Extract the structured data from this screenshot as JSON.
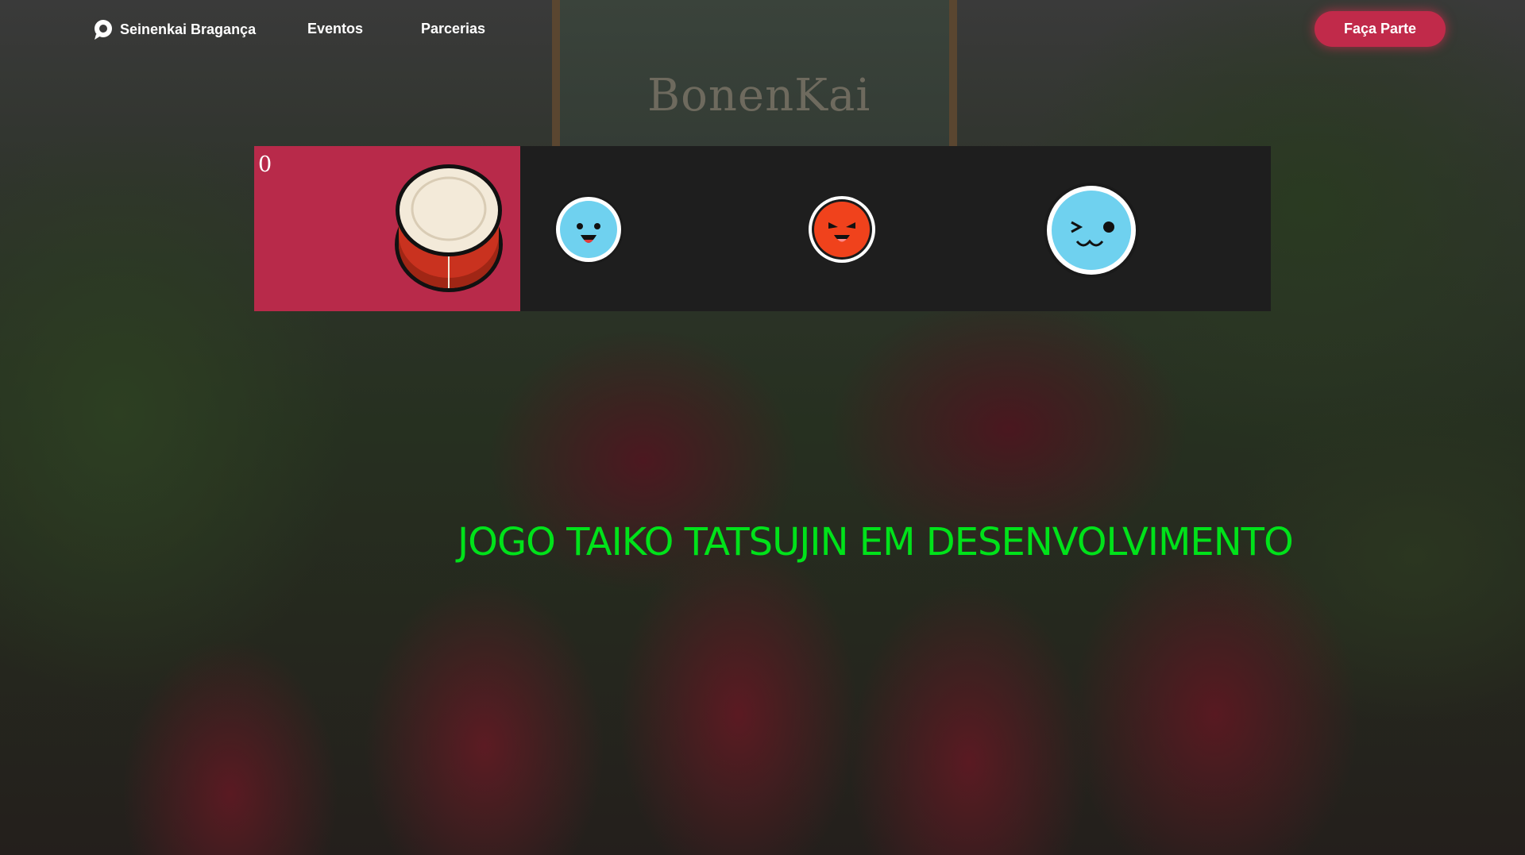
{
  "nav": {
    "brand": "Seinenkai Bragança",
    "links": [
      "Eventos",
      "Parcerias"
    ],
    "cta": "Faça Parte"
  },
  "background": {
    "board_text": "BonenKai"
  },
  "game": {
    "score": "0",
    "notes": [
      "don-blue-note",
      "don-red-note",
      "ka-big-blue-note"
    ]
  },
  "headline": "JOGO TAIKO TATSUJIN EM DESENVOLVIMENTO",
  "colors": {
    "accent": "#c12a4a",
    "drum_panel": "#b82a4a",
    "game_track": "#1e1e1e",
    "headline": "#00e21a",
    "note_blue": "#6fd1ef",
    "note_red": "#f0421c"
  }
}
